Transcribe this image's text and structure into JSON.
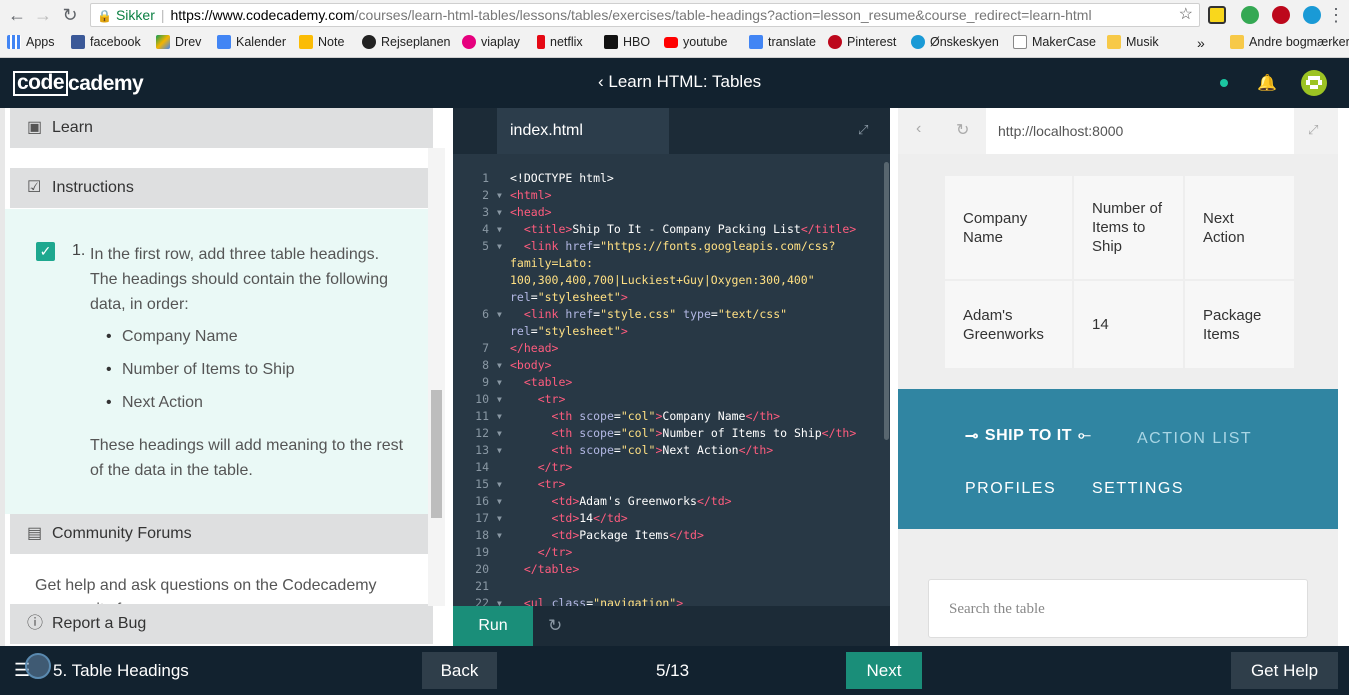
{
  "browser": {
    "secure_label": "Sikker",
    "url_host": "https://www.codecademy.com",
    "url_path": "/courses/learn-html-tables/lessons/tables/exercises/table-headings?action=lesson_resume&course_redirect=learn-html",
    "bookmarks": [
      {
        "label": "Apps",
        "color": "#4285f4"
      },
      {
        "label": "facebook",
        "color": "#3b5998"
      },
      {
        "label": "Drev",
        "color": "#f4b400"
      },
      {
        "label": "Kalender",
        "color": "#4285f4"
      },
      {
        "label": "Note",
        "color": "#fbbc05"
      },
      {
        "label": "Rejseplanen",
        "color": "#222222"
      },
      {
        "label": "viaplay",
        "color": "#e6007e"
      },
      {
        "label": "netflix",
        "color": "#e50914"
      },
      {
        "label": "HBO",
        "color": "#111111"
      },
      {
        "label": "youtube",
        "color": "#ff0000"
      },
      {
        "label": "translate",
        "color": "#4285f4"
      },
      {
        "label": "Pinterest",
        "color": "#bd081c"
      },
      {
        "label": "Ønskeskyen",
        "color": "#1a9ad6"
      },
      {
        "label": "MakerCase",
        "color": "#888888"
      },
      {
        "label": "Musik",
        "color": "#f7c948"
      }
    ],
    "more_label": "»",
    "other_bookmarks": "Andre bogmærker"
  },
  "topbar": {
    "logo_code": "code",
    "logo_cademy": "cademy",
    "course_title": "‹ Learn HTML: Tables"
  },
  "left": {
    "learn_label": "Learn",
    "instructions_label": "Instructions",
    "step_number": "1.",
    "instruction_text": "In the first row, add three table headings. The headings should contain the following data, in order:",
    "bullets": [
      "Company Name",
      "Number of Items to Ship",
      "Next Action"
    ],
    "note": "These headings will add meaning to the rest of the data in the table.",
    "community_label": "Community Forums",
    "community_text": "Get help and ask questions on the Codecademy community forums.",
    "report_label": "Report a Bug"
  },
  "editor": {
    "filename": "index.html",
    "run_label": "Run"
  },
  "preview": {
    "url": "http://localhost:8000",
    "table": {
      "headers": [
        "Company Name",
        "Number of Items to Ship",
        "Next Action"
      ],
      "row": [
        "Adam's Greenworks",
        "14",
        "Package Items"
      ]
    },
    "nav": {
      "brand": "SHIP TO IT",
      "action_list": "ACTION LIST",
      "profiles": "PROFILES",
      "settings": "SETTINGS"
    },
    "search_placeholder": "Search the table"
  },
  "bottom": {
    "lesson": "5. Table Headings",
    "back": "Back",
    "progress": "5/13",
    "next": "Next",
    "help": "Get Help"
  },
  "colors": {
    "accent": "#1a8e79",
    "nav_band": "#3085a2",
    "dark_bar": "#12222f"
  }
}
